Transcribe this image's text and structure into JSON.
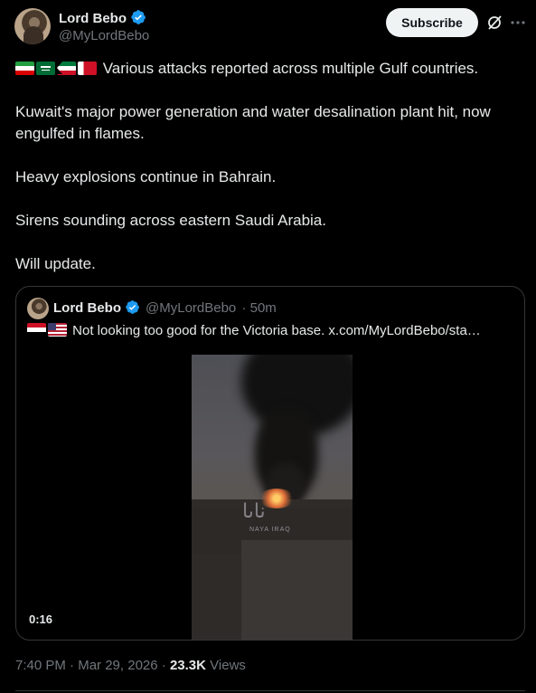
{
  "author": {
    "name": "Lord Bebo",
    "handle": "@MyLordBebo",
    "verified_icon": "verified-badge-icon"
  },
  "actions": {
    "subscribe_label": "Subscribe",
    "grok_icon": "grok-icon",
    "more_icon": "more-options-icon"
  },
  "tweet": {
    "flags": [
      "iran-flag",
      "saudi-arabia-flag",
      "kuwait-flag",
      "bahrain-flag"
    ],
    "line1": "Various attacks reported across multiple Gulf countries.",
    "para2": "Kuwait's major power generation and water desalination plant hit, now engulfed in flames.",
    "para3": "Heavy explosions continue in Bahrain.",
    "para4": "Sirens sounding across eastern Saudi Arabia.",
    "para5": "Will update."
  },
  "quoted": {
    "name": "Lord Bebo",
    "handle": "@MyLordBebo",
    "time": "· 50m",
    "flags": [
      "iraq-flag",
      "usa-flag"
    ],
    "text": "Not looking too good for the Victoria base.  x.com/MyLordBebo/sta…",
    "video": {
      "watermark": "ناىا",
      "watermark_sub": "NAYA IRAQ",
      "duration": "0:16"
    }
  },
  "meta": {
    "time": "7:40 PM",
    "date": "Mar 29, 2026",
    "views_count": "23.3K",
    "views_label": "Views"
  },
  "colors": {
    "background": "#000000",
    "text": "#e7e9ea",
    "secondary": "#71767b",
    "verified": "#1d9bf0",
    "button_bg": "#eff3f4"
  }
}
